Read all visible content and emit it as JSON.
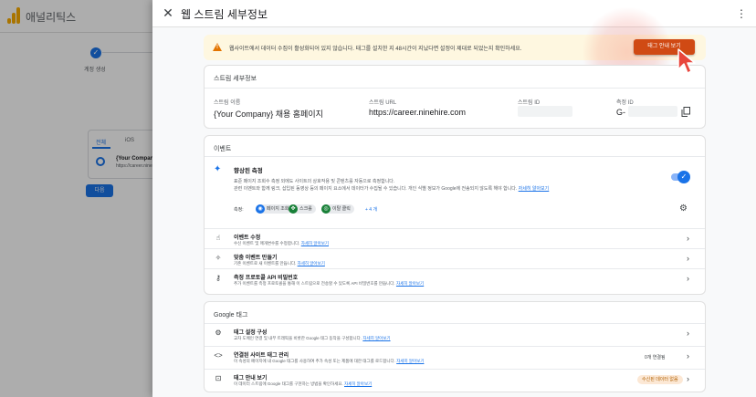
{
  "background": {
    "app_title": "애널리틱스",
    "step_label": "계정 생성",
    "step_check": "✓",
    "tabs": [
      "전체",
      "iOS"
    ],
    "stream_name": "{Your Company",
    "stream_url": "https://career.nine",
    "next_button": "다음"
  },
  "panel": {
    "title": "웹 스트림 세부정보",
    "close_glyph": "✕",
    "more_glyph": "⋮",
    "warning": {
      "text": "웹사이트에서 데이터 수집이 활성화되어 있지 않습니다. 태그를 설치한 지 48시간이 지났다면 설정이 제대로 되었는지 확인하세요.",
      "button": "태그 안내 보기",
      "accent": "#d04a14"
    },
    "stream_details": {
      "heading": "스트림 세부정보",
      "name_label": "스트림 이름",
      "name_value": "{Your Company} 채용 홈페이지",
      "url_label": "스트림 URL",
      "url_value": "https://career.ninehire.com",
      "id_label": "스트림 ID",
      "measurement_label": "측정 ID",
      "measurement_value": "G-"
    },
    "events": {
      "heading": "이벤트",
      "enhanced": {
        "title": "향상된 측정",
        "desc_line1": "표준 페이지 조회수 측정 외에도 사이트의 상호작용 및 콘텐츠를 자동으로 측정합니다.",
        "desc_line2": "관련 이벤트와 함께 링크, 삽입된 동영상 등의 페이지 요소에서 데이터가 수집될 수 있습니다. 개인 식별 정보가 Google에 전송되지 않도록 해야 합니다.",
        "learn_more": "자세히 알아보기",
        "measure_label": "측정:",
        "chips": [
          "페이지 조회",
          "스크롤",
          "이탈 클릭"
        ],
        "more": "+ 4 개",
        "toggle_on": true,
        "toggle_check": "✓"
      },
      "rows": [
        {
          "title": "이벤트 수정",
          "desc": "수신 이벤트 및 매개변수를 수정합니다.",
          "link": "자세히 알아보기"
        },
        {
          "title": "맞춤 이벤트 만들기",
          "desc": "기존 이벤트로 새 이벤트를 만듭니다.",
          "link": "자세히 알아보기"
        },
        {
          "title": "측정 프로토콜 API 비밀번호",
          "desc": "추가 이벤트를 측정 프로토콜을 통해 이 스트림으로 전송할 수 있도록 API 비밀번호를 만듭니다.",
          "link": "자세히 알아보기"
        }
      ]
    },
    "google_tag": {
      "heading": "Google 태그",
      "rows": [
        {
          "title": "태그 설정 구성",
          "desc": "교차 도메인 연결 및 내부 트래픽을 비롯한 Google 태그 동작을 구성합니다.",
          "link": "자세히 알아보기",
          "meta": ""
        },
        {
          "title": "연결된 사이트 태그 관리",
          "desc": "이 속성의 페이지에 내 Google 태그를 사용하여 추가 속성 또는 제품에 대한 태그를 로드합니다.",
          "link": "자세히 알아보기",
          "meta": "0개 연결됨"
        },
        {
          "title": "태그 안내 보기",
          "desc": "이 데이터 스트림에 Google 태그를 구현하는 방법을 확인하세요.",
          "link": "자세히 알아보기",
          "meta": "수신된 데이터 없음"
        }
      ]
    },
    "icons": {
      "chevron": "›",
      "settings": "⚙"
    }
  }
}
